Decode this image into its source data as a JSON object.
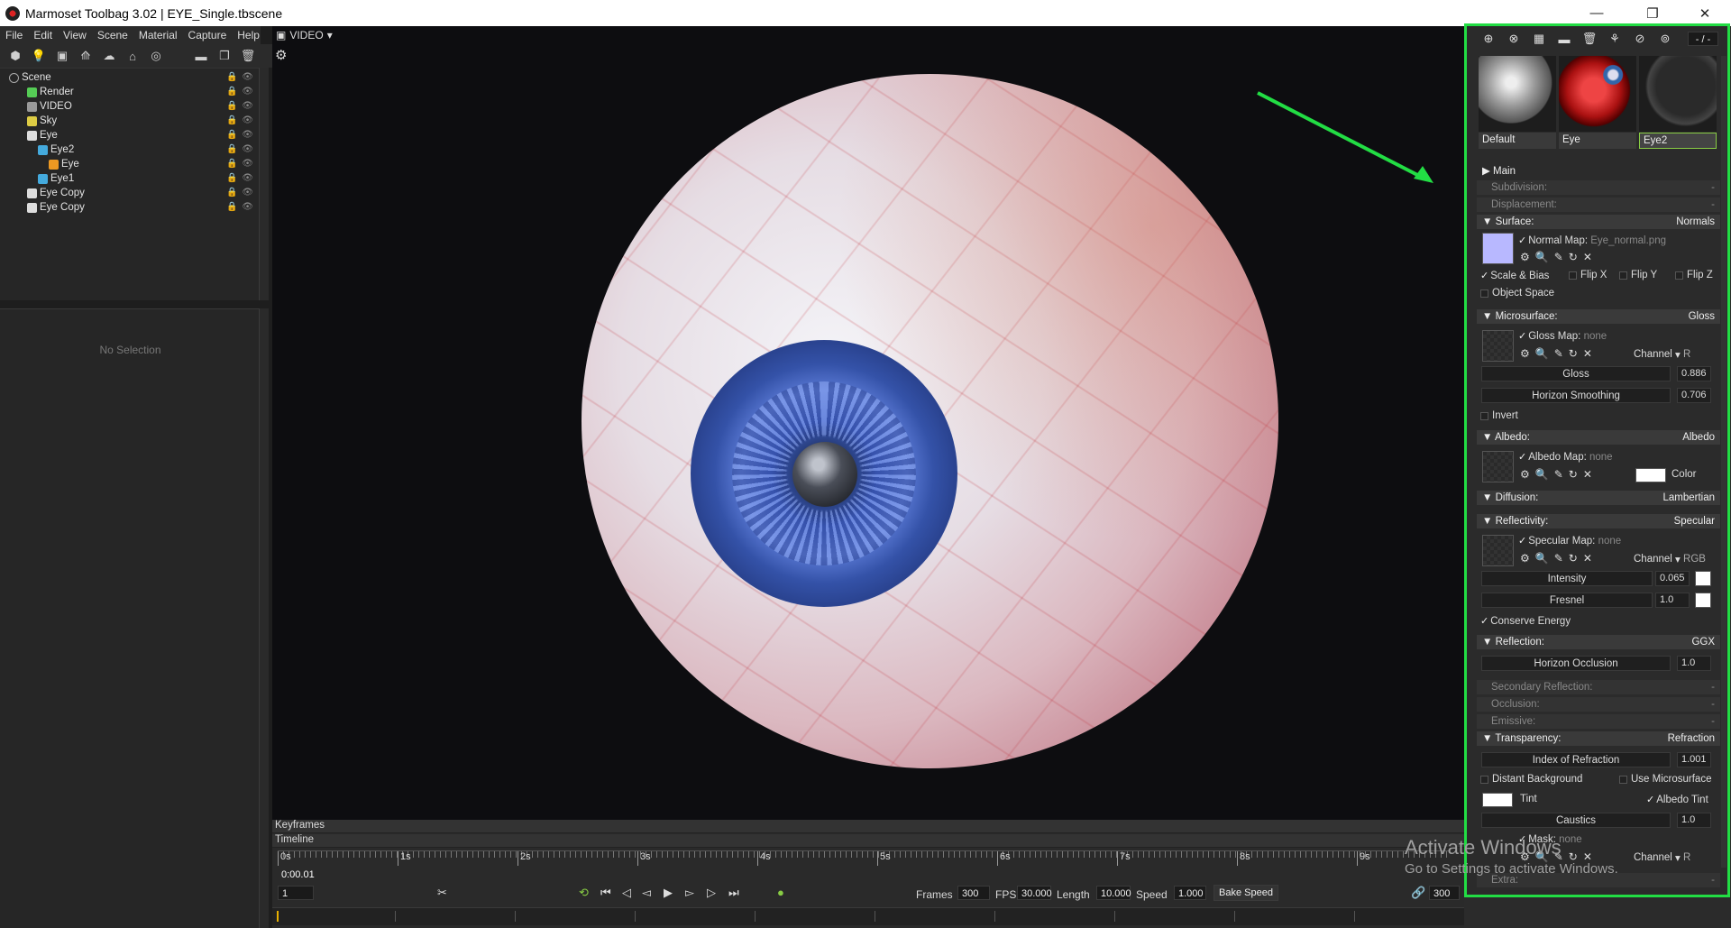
{
  "window": {
    "title": "Marmoset Toolbag 3.02  |  EYE_Single.tbscene",
    "minimize": "—",
    "maximize": "❐",
    "close": "✕"
  },
  "menu": [
    "File",
    "Edit",
    "View",
    "Scene",
    "Material",
    "Capture",
    "Help"
  ],
  "scene_tree": [
    {
      "label": "Scene",
      "icon": "scene-icon"
    },
    {
      "label": "Render",
      "icon": "render-icon"
    },
    {
      "label": "VIDEO",
      "icon": "camera-icon"
    },
    {
      "label": "Sky",
      "icon": "sky-icon"
    },
    {
      "label": "Eye",
      "icon": "object-icon"
    },
    {
      "label": "Eye2",
      "icon": "mesh-icon"
    },
    {
      "label": "Eye",
      "icon": "submesh-icon"
    },
    {
      "label": "Eye1",
      "icon": "mesh-icon"
    },
    {
      "label": "Eye Copy",
      "icon": "object-icon"
    },
    {
      "label": "Eye Copy",
      "icon": "object-icon"
    }
  ],
  "properties": {
    "empty_text": "No Selection"
  },
  "viewport": {
    "camera_label": "VIDEO"
  },
  "timeline": {
    "keyframes_label": "Keyframes",
    "timeline_label": "Timeline",
    "ticks": [
      "0s",
      "1s",
      "2s",
      "3s",
      "4s",
      "5s",
      "6s",
      "7s",
      "8s",
      "9s"
    ],
    "current_time": "0:00.01",
    "frame_field": "1",
    "frames_label": "Frames",
    "frames": "300",
    "fps_label": "FPS",
    "fps": "30.000",
    "length_label": "Length",
    "length": "10.000",
    "speed_label": "Speed",
    "speed": "1.000",
    "bake_speed": "Bake Speed",
    "end_frame": "300"
  },
  "materials": {
    "counter": "- / -",
    "thumbs": [
      "Default",
      "Eye",
      "Eye2"
    ],
    "selected": "Eye2"
  },
  "mat": {
    "main": "Main",
    "subdivision": "Subdivision:",
    "displacement": "Displacement:",
    "dash": "-",
    "surface": "Surface:",
    "surface_mode": "Normals",
    "normal_map_label": "Normal Map:",
    "normal_map_file": "Eye_normal.png",
    "scale_bias": "Scale & Bias",
    "flip_x": "Flip X",
    "flip_y": "Flip Y",
    "flip_z": "Flip Z",
    "object_space": "Object Space",
    "microsurface": "Microsurface:",
    "micro_mode": "Gloss",
    "gloss_map_label": "Gloss Map:",
    "none": "none",
    "channel": "Channel",
    "channel_r": "R",
    "channel_rgb": "RGB",
    "gloss": "Gloss",
    "gloss_value": "0.886",
    "horizon_smoothing": "Horizon Smoothing",
    "horizon_smoothing_value": "0.706",
    "invert": "Invert",
    "albedo": "Albedo:",
    "albedo_mode": "Albedo",
    "albedo_map_label": "Albedo Map:",
    "color": "Color",
    "diffusion": "Diffusion:",
    "diffusion_mode": "Lambertian",
    "reflectivity": "Reflectivity:",
    "reflectivity_mode": "Specular",
    "specular_map_label": "Specular Map:",
    "intensity": "Intensity",
    "intensity_value": "0.065",
    "fresnel": "Fresnel",
    "fresnel_value": "1.0",
    "conserve_energy": "Conserve Energy",
    "reflection": "Reflection:",
    "reflection_mode": "GGX",
    "horizon_occlusion": "Horizon Occlusion",
    "horizon_occlusion_value": "1.0",
    "secondary_reflection": "Secondary Reflection:",
    "occlusion": "Occlusion:",
    "emissive": "Emissive:",
    "transparency": "Transparency:",
    "transparency_mode": "Refraction",
    "ior": "Index of Refraction",
    "ior_value": "1.001",
    "distant_background": "Distant Background",
    "use_microsurface": "Use Microsurface",
    "tint": "Tint",
    "albedo_tint": "Albedo Tint",
    "caustics": "Caustics",
    "caustics_value": "1.0",
    "mask_label": "Mask:",
    "extra": "Extra:"
  },
  "watermark": {
    "line1": "Activate Windows",
    "line2": "Go to Settings to activate Windows."
  },
  "colors": {
    "highlight": "#22dd44",
    "panel": "#2b2b2b",
    "normal_swatch": "#b8b8ff"
  }
}
